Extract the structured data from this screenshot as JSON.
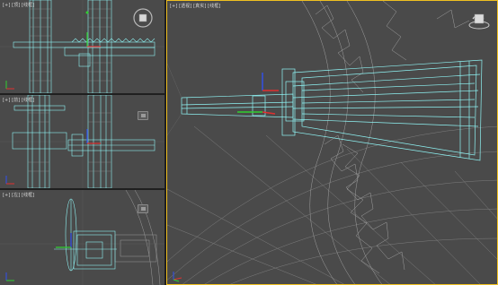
{
  "viewports": {
    "top": {
      "label": "[+] [顶] [线框]"
    },
    "front": {
      "label": "[+] [前] [线框]"
    },
    "left": {
      "label": "[+] [左] [线框]"
    },
    "perspective": {
      "label": "[+] [透视] [真实] [线框]"
    }
  },
  "colors": {
    "viewport_bg": "#4a4a4a",
    "frame_bg": "#1f1f1f",
    "wire_selected": "#8ff4f4",
    "wire_grey": "#9a9a9a",
    "active_border": "#f0c020",
    "axis_x": "#e03030",
    "axis_y": "#30d030",
    "axis_z": "#3050f0"
  },
  "icons": {
    "viewcube": "viewcube-icon",
    "steering": "steering-wheel-icon"
  }
}
